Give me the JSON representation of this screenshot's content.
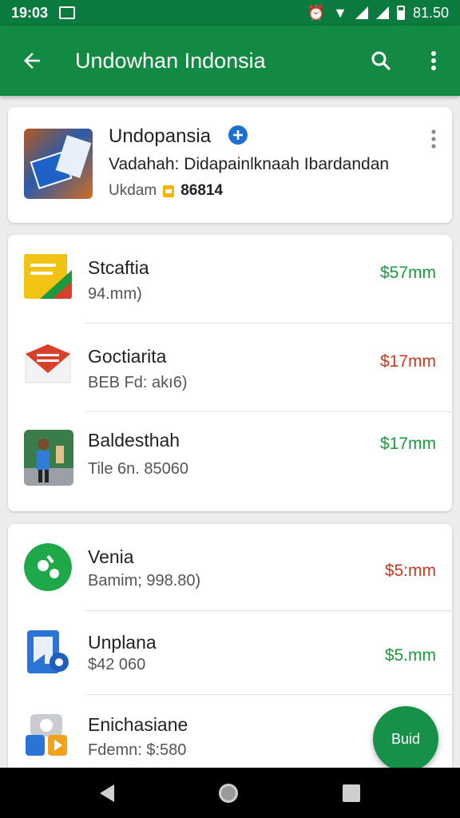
{
  "status": {
    "time": "19:03",
    "battery": "81.50"
  },
  "header": {
    "title": "Undowhan Indonsia"
  },
  "featured": {
    "name": "Undopansia",
    "description": "Vadahah: Didapainlknaah Ibardandan",
    "meta_label": "Ukdam",
    "meta_value": "86814"
  },
  "group1": [
    {
      "label": "Stcaftia",
      "sub": "94.mm)",
      "price": "$57mm",
      "price_color": "#1a9a3d"
    },
    {
      "label": "Goctiarita",
      "sub": "BEB Fd: akı6)",
      "price": "$17mm",
      "price_color": "#c8391f"
    },
    {
      "label": "Baldesthah",
      "sub": "Tile 6n. 85060",
      "price": "$17mm",
      "price_color": "#1a9a3d"
    }
  ],
  "group2": [
    {
      "label": "Venia",
      "sub": "Bamim; 998.80)",
      "price": "$5:mm",
      "price_color": "#c8391f"
    },
    {
      "label": "Unplana",
      "sub": "$42 060",
      "price": "$5.mm",
      "price_color": "#1a9a3d"
    },
    {
      "label": "Enichasiane",
      "sub": "Fdemn: $:580",
      "price": "",
      "price_color": "#1a9a3d"
    }
  ],
  "fab": {
    "label": "Buid"
  }
}
